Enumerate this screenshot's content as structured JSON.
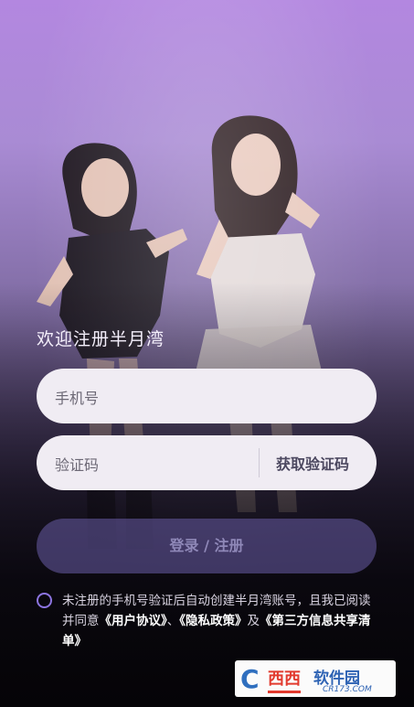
{
  "form": {
    "welcome": "欢迎注册半月湾",
    "phone_placeholder": "手机号",
    "code_placeholder": "验证码",
    "get_code": "获取验证码",
    "submit": "登录 / 注册"
  },
  "agreement": {
    "text_before": "未注册的手机号验证后自动创建半月湾账号，且我已阅读并同意",
    "user_agreement": "《用户协议》",
    "sep1": "、",
    "privacy_policy": "《隐私政策》",
    "sep2": "及",
    "third_party": "《第三方信息共享清单》"
  },
  "watermark": {
    "logo_letter": "C",
    "logo_mark": "西西",
    "name": "软件园",
    "site": "CR173.COM"
  },
  "colors": {
    "accent": "#8c74e0",
    "button_bg": "#60549a",
    "gradient_top": "#b387e0"
  }
}
